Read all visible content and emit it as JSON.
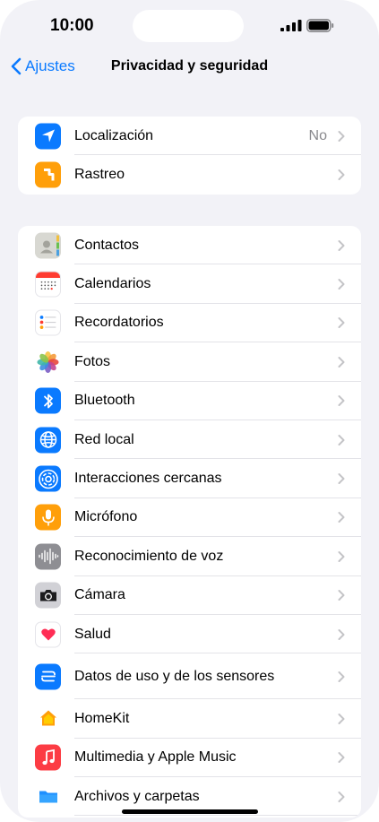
{
  "status_bar": {
    "time": "10:00"
  },
  "nav": {
    "back_label": "Ajustes",
    "title": "Privacidad y seguridad"
  },
  "group1": [
    {
      "label": "Localización",
      "value": "No",
      "icon": "location-arrow-icon",
      "color": "#0a7aff"
    },
    {
      "label": "Rastreo",
      "value": "",
      "icon": "tracking-icon",
      "color": "#ff9f0a"
    }
  ],
  "group2": [
    {
      "label": "Contactos",
      "icon": "contacts-icon",
      "color": "#d8d8d2"
    },
    {
      "label": "Calendarios",
      "icon": "calendar-icon",
      "color": "#ffffff"
    },
    {
      "label": "Recordatorios",
      "icon": "reminders-icon",
      "color": "#ffffff"
    },
    {
      "label": "Fotos",
      "icon": "photos-icon",
      "color": "#ffffff"
    },
    {
      "label": "Bluetooth",
      "icon": "bluetooth-icon",
      "color": "#0a7aff"
    },
    {
      "label": "Red local",
      "icon": "globe-icon",
      "color": "#0a7aff"
    },
    {
      "label": "Interacciones cercanas",
      "icon": "nearby-interactions-icon",
      "color": "#0a7aff"
    },
    {
      "label": "Micrófono",
      "icon": "microphone-icon",
      "color": "#ff9f0a"
    },
    {
      "label": "Reconocimiento de voz",
      "icon": "speech-waveform-icon",
      "color": "#8e8e93"
    },
    {
      "label": "Cámara",
      "icon": "camera-icon",
      "color": "#d1d1d6"
    },
    {
      "label": "Salud",
      "icon": "health-heart-icon",
      "color": "#ffffff"
    },
    {
      "label": "Datos de uso y de los sensores",
      "icon": "sensor-data-icon",
      "color": "#0a7aff"
    },
    {
      "label": "HomeKit",
      "icon": "homekit-icon",
      "color": "#ffffff"
    },
    {
      "label": "Multimedia y Apple Music",
      "icon": "music-note-icon",
      "color": "#fc3c44"
    },
    {
      "label": "Archivos y carpetas",
      "icon": "folder-icon",
      "color": "#ffffff"
    }
  ]
}
